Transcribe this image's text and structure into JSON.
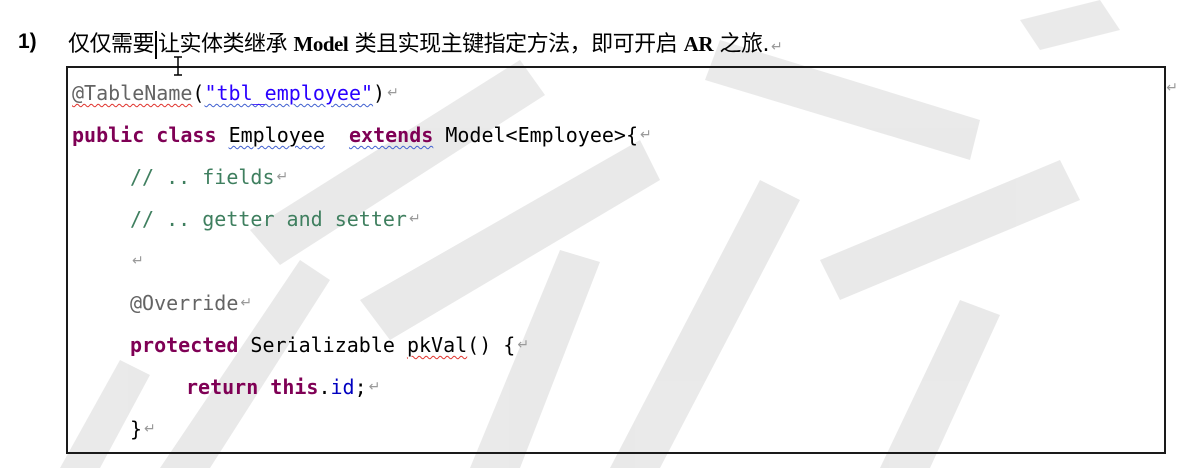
{
  "heading": {
    "number": "1)",
    "text_before": "仅仅需要",
    "text_middle": "让实体类继承 ",
    "model_word": "Model",
    "text_after": " 类且实现主键指定方法，即可开启 ",
    "ar_word": "AR",
    "text_end": " 之旅."
  },
  "paragraph_mark": "↵",
  "code": {
    "line1": {
      "annotation": "@TableName",
      "open": "(",
      "string": "\"tbl_employee\"",
      "close": ")"
    },
    "line2": {
      "kw_public": "public",
      "kw_class": "class",
      "class_name": "Employee",
      "kw_extends": "extends",
      "rest": "Model<Employee>{"
    },
    "line3": {
      "comment": "// .. fields"
    },
    "line4": {
      "comment": "// .. getter and setter"
    },
    "line6": {
      "annotation": "@Override"
    },
    "line7": {
      "kw_protected": "protected",
      "rest_a": " Serializable ",
      "method": "pkVal",
      "rest_b": "() {"
    },
    "line8": {
      "kw_return": "return",
      "kw_this": "this",
      "dot": ".",
      "field": "id",
      "semi": ";"
    },
    "line9": {
      "brace": "}"
    }
  }
}
